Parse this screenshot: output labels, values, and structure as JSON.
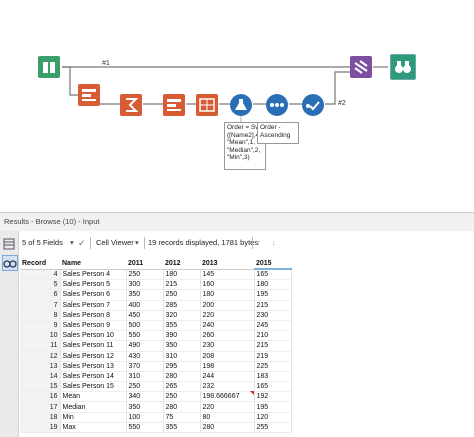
{
  "canvas": {
    "wire_label_top": "#1",
    "wire_label_bottom": "#2",
    "annotation_sort": "Order = Sw\n([Name2],4\n\"Mean\",1,\n\"Median\",2,\n\"Min\",3)",
    "annotation_sort2": "Order -\nAscending"
  },
  "results": {
    "title": "Results - Browse (10) - Input",
    "fields_label": "5 of 5 Fields",
    "cell_viewer_label": "Cell Viewer",
    "records_info": "19 records displayed, 1781 bytes",
    "columns": [
      "Record",
      "Name",
      "2011",
      "2012",
      "2013",
      "2015"
    ],
    "rows": [
      [
        "4",
        "Sales Person 4",
        "250",
        "180",
        "145",
        "165"
      ],
      [
        "5",
        "Sales Person 5",
        "300",
        "215",
        "160",
        "180"
      ],
      [
        "6",
        "Sales Person 6",
        "350",
        "250",
        "180",
        "195"
      ],
      [
        "7",
        "Sales Person 7",
        "400",
        "285",
        "200",
        "215"
      ],
      [
        "8",
        "Sales Person 8",
        "450",
        "320",
        "220",
        "230"
      ],
      [
        "9",
        "Sales Person 9",
        "500",
        "355",
        "240",
        "245"
      ],
      [
        "10",
        "Sales Person 10",
        "550",
        "390",
        "260",
        "210"
      ],
      [
        "11",
        "Sales Person 11",
        "490",
        "350",
        "230",
        "215"
      ],
      [
        "12",
        "Sales Person 12",
        "430",
        "310",
        "208",
        "219"
      ],
      [
        "13",
        "Sales Person 13",
        "370",
        "295",
        "198",
        "225"
      ],
      [
        "14",
        "Sales Person 14",
        "310",
        "280",
        "244",
        "183"
      ],
      [
        "15",
        "Sales Person 15",
        "250",
        "265",
        "232",
        "165"
      ],
      [
        "16",
        "Mean",
        "340",
        "250",
        "198.666667",
        "192"
      ],
      [
        "17",
        "Median",
        "350",
        "280",
        "220",
        "195"
      ],
      [
        "18",
        "Min",
        "100",
        "75",
        "80",
        "120"
      ],
      [
        "19",
        "Max",
        "550",
        "355",
        "280",
        "255"
      ]
    ]
  }
}
